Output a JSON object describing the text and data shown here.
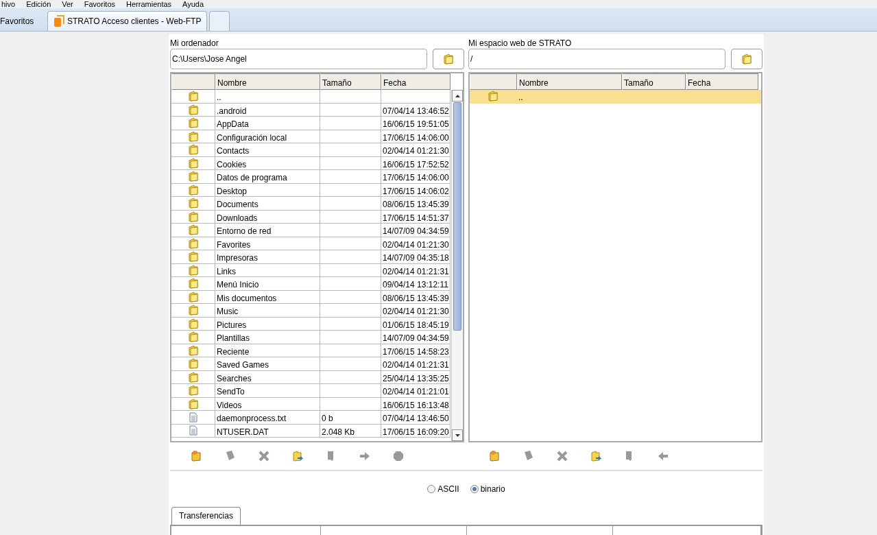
{
  "menu_bar": [
    "hivo",
    "Edición",
    "Ver",
    "Favoritos",
    "Herramientas",
    "Ayuda"
  ],
  "favorites_button": {
    "label": "Favoritos"
  },
  "browser_tabs": [
    {
      "label": "STRATO Acceso clientes - Web-FTP",
      "selected": true
    }
  ],
  "new_tab_button": true,
  "panels": [
    {
      "title": "Mi ordenador",
      "path": "C:\\Users\\Jose Angel",
      "columns": [
        "Nombre",
        "Tamaño",
        "Fecha"
      ],
      "scrollbar": true,
      "rows": [
        {
          "kind": "folder",
          "name": "..",
          "size": "",
          "date": "",
          "selected": false
        },
        {
          "kind": "folder",
          "name": ".android",
          "size": "",
          "date": "07/04/14 13:46:52",
          "selected": false
        },
        {
          "kind": "folder",
          "name": "AppData",
          "size": "",
          "date": "16/06/15 19:51:05",
          "selected": false
        },
        {
          "kind": "folder",
          "name": "Configuración local",
          "size": "",
          "date": "17/06/15 14:06:00",
          "selected": false
        },
        {
          "kind": "folder",
          "name": "Contacts",
          "size": "",
          "date": "02/04/14 01:21:30",
          "selected": false
        },
        {
          "kind": "folder",
          "name": "Cookies",
          "size": "",
          "date": "16/06/15 17:52:52",
          "selected": false
        },
        {
          "kind": "folder",
          "name": "Datos de programa",
          "size": "",
          "date": "17/06/15 14:06:00",
          "selected": false
        },
        {
          "kind": "folder",
          "name": "Desktop",
          "size": "",
          "date": "17/06/15 14:06:02",
          "selected": false
        },
        {
          "kind": "folder",
          "name": "Documents",
          "size": "",
          "date": "08/06/15 13:45:39",
          "selected": false
        },
        {
          "kind": "folder",
          "name": "Downloads",
          "size": "",
          "date": "17/06/15 14:51:37",
          "selected": false
        },
        {
          "kind": "folder",
          "name": "Entorno de red",
          "size": "",
          "date": "14/07/09 04:34:59",
          "selected": false
        },
        {
          "kind": "folder",
          "name": "Favorites",
          "size": "",
          "date": "02/04/14 01:21:30",
          "selected": false
        },
        {
          "kind": "folder",
          "name": "Impresoras",
          "size": "",
          "date": "14/07/09 04:35:18",
          "selected": false
        },
        {
          "kind": "folder",
          "name": "Links",
          "size": "",
          "date": "02/04/14 01:21:31",
          "selected": false
        },
        {
          "kind": "folder",
          "name": "Menú Inicio",
          "size": "",
          "date": "09/04/14 13:12:11",
          "selected": false
        },
        {
          "kind": "folder",
          "name": "Mis documentos",
          "size": "",
          "date": "08/06/15 13:45:39",
          "selected": false
        },
        {
          "kind": "folder",
          "name": "Music",
          "size": "",
          "date": "02/04/14 01:21:30",
          "selected": false
        },
        {
          "kind": "folder",
          "name": "Pictures",
          "size": "",
          "date": "01/06/15 18:45:19",
          "selected": false
        },
        {
          "kind": "folder",
          "name": "Plantillas",
          "size": "",
          "date": "14/07/09 04:34:59",
          "selected": false
        },
        {
          "kind": "folder",
          "name": "Reciente",
          "size": "",
          "date": "17/06/15 14:58:23",
          "selected": false
        },
        {
          "kind": "folder",
          "name": "Saved Games",
          "size": "",
          "date": "02/04/14 01:21:31",
          "selected": false
        },
        {
          "kind": "folder",
          "name": "Searches",
          "size": "",
          "date": "25/04/14 13:35:25",
          "selected": false
        },
        {
          "kind": "folder",
          "name": "SendTo",
          "size": "",
          "date": "02/04/14 01:21:01",
          "selected": false
        },
        {
          "kind": "folder",
          "name": "Videos",
          "size": "",
          "date": "16/06/15 16:13:48",
          "selected": false
        },
        {
          "kind": "file",
          "name": "daemonprocess.txt",
          "size": "0 b",
          "date": "07/04/14 13:46:50",
          "selected": false
        },
        {
          "kind": "file",
          "name": "NTUSER.DAT",
          "size": "2.048 Kb",
          "date": "17/06/15 16:09:20",
          "selected": false
        }
      ],
      "toolbar": [
        {
          "kind": "new-folder",
          "disabled": false
        },
        {
          "kind": "rename",
          "disabled": true
        },
        {
          "kind": "delete",
          "disabled": true
        },
        {
          "kind": "refresh",
          "disabled": false
        },
        {
          "kind": "properties",
          "disabled": true
        },
        {
          "kind": "upload",
          "disabled": true
        },
        {
          "kind": "stop",
          "disabled": true
        }
      ]
    },
    {
      "title": "Mi espacio web de STRATO",
      "path": "/",
      "columns": [
        "Nombre",
        "Tamaño",
        "Fecha"
      ],
      "scrollbar": false,
      "rows": [
        {
          "kind": "folder",
          "name": "..",
          "size": "",
          "date": "",
          "selected": true
        }
      ],
      "toolbar": [
        {
          "kind": "new-folder",
          "disabled": false
        },
        {
          "kind": "rename",
          "disabled": true
        },
        {
          "kind": "delete",
          "disabled": true
        },
        {
          "kind": "refresh",
          "disabled": false
        },
        {
          "kind": "properties",
          "disabled": true
        },
        {
          "kind": "download",
          "disabled": true
        }
      ]
    }
  ],
  "transfer_mode": [
    {
      "label": "ASCII",
      "selected": false
    },
    {
      "label": "binario",
      "selected": true
    }
  ],
  "bottom_tabs": [
    {
      "label": "Transferencias",
      "selected": true
    }
  ]
}
